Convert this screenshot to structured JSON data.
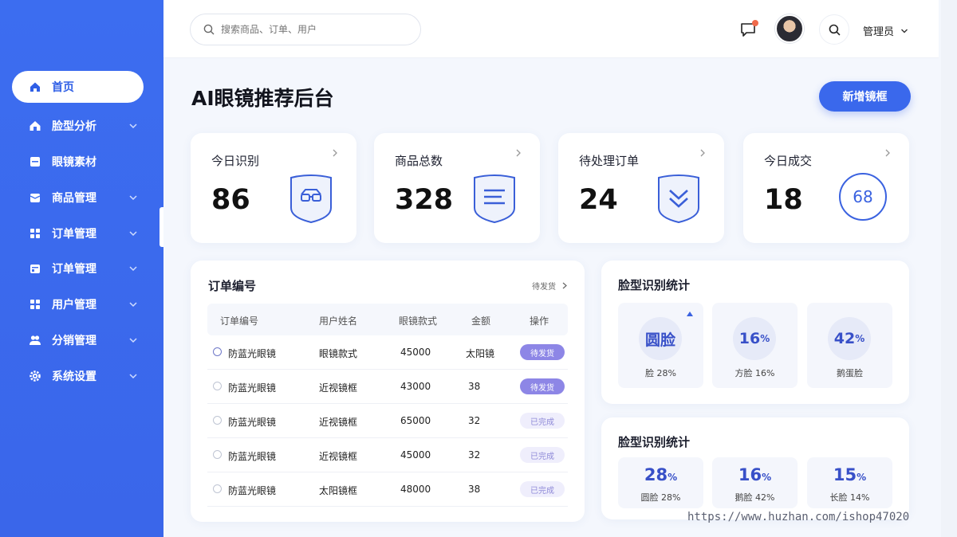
{
  "colors": {
    "accent": "#3a68ec",
    "sidebar": "#3c6df0",
    "badge_pending": "#8d86e6",
    "badge_done_bg": "#efeefc"
  },
  "sidebar": {
    "items": [
      {
        "label": "首页",
        "icon": "home-icon"
      },
      {
        "label": "脸型分析",
        "icon": "house-icon"
      },
      {
        "label": "眼镜素材",
        "icon": "archive-icon"
      },
      {
        "label": "商品管理",
        "icon": "box-icon"
      },
      {
        "label": "订单管理",
        "icon": "grid-icon"
      },
      {
        "label": "订单管理",
        "icon": "cart-icon"
      },
      {
        "label": "用户管理",
        "icon": "grid-icon"
      },
      {
        "label": "分销管理",
        "icon": "people-icon"
      },
      {
        "label": "系统设置",
        "icon": "gear-icon"
      }
    ]
  },
  "header": {
    "search_placeholder": "搜索商品、订单、用户",
    "user_label": "管理员"
  },
  "page": {
    "title": "AI眼镜推荐后台",
    "add_button": "新增镜框"
  },
  "stats": [
    {
      "label": "今日识别",
      "value": "86"
    },
    {
      "label": "商品总数",
      "value": "328"
    },
    {
      "label": "待处理订单",
      "value": "24"
    },
    {
      "label": "今日成交",
      "value": "18",
      "badge": "68"
    }
  ],
  "orders": {
    "title": "订单编号",
    "more_label": "待发货",
    "columns": [
      "订单编号",
      "用户姓名",
      "眼镜款式",
      "金额",
      "操作"
    ],
    "rows": [
      {
        "name": "防蓝光眼镜",
        "style": "眼镜款式",
        "id": "45000",
        "amount": "太阳镜",
        "status": "待发货",
        "state": "pending"
      },
      {
        "name": "防蓝光眼镜",
        "style": "近视镜框",
        "id": "43000",
        "amount": "38",
        "status": "待发货",
        "state": "pending"
      },
      {
        "name": "防蓝光眼镜",
        "style": "近视镜框",
        "id": "65000",
        "amount": "32",
        "status": "已完成",
        "state": "done"
      },
      {
        "name": "防蓝光眼镜",
        "style": "近视镜框",
        "id": "45000",
        "amount": "32",
        "status": "已完成",
        "state": "done"
      },
      {
        "name": "防蓝光眼镜",
        "style": "太阳镜框",
        "id": "48000",
        "amount": "38",
        "status": "已完成",
        "state": "done"
      }
    ]
  },
  "face_stats_1": {
    "title": "脸型识别统计",
    "tiles": [
      {
        "main": "圆脸",
        "caption": "脸 28%"
      },
      {
        "main": "16",
        "unit": "%",
        "caption": "方脸 16%"
      },
      {
        "main": "42",
        "unit": "%",
        "caption": "鹅蛋脸"
      }
    ]
  },
  "face_stats_2": {
    "title": "脸型识别统计",
    "tiles": [
      {
        "main": "28",
        "unit": "%",
        "caption": "圆脸 28%"
      },
      {
        "main": "16",
        "unit": "%",
        "caption": "鹅脸 42%"
      },
      {
        "main": "15",
        "unit": "%",
        "caption": "长脸 14%"
      }
    ]
  },
  "watermark": "https://www.huzhan.com/ishop47020"
}
